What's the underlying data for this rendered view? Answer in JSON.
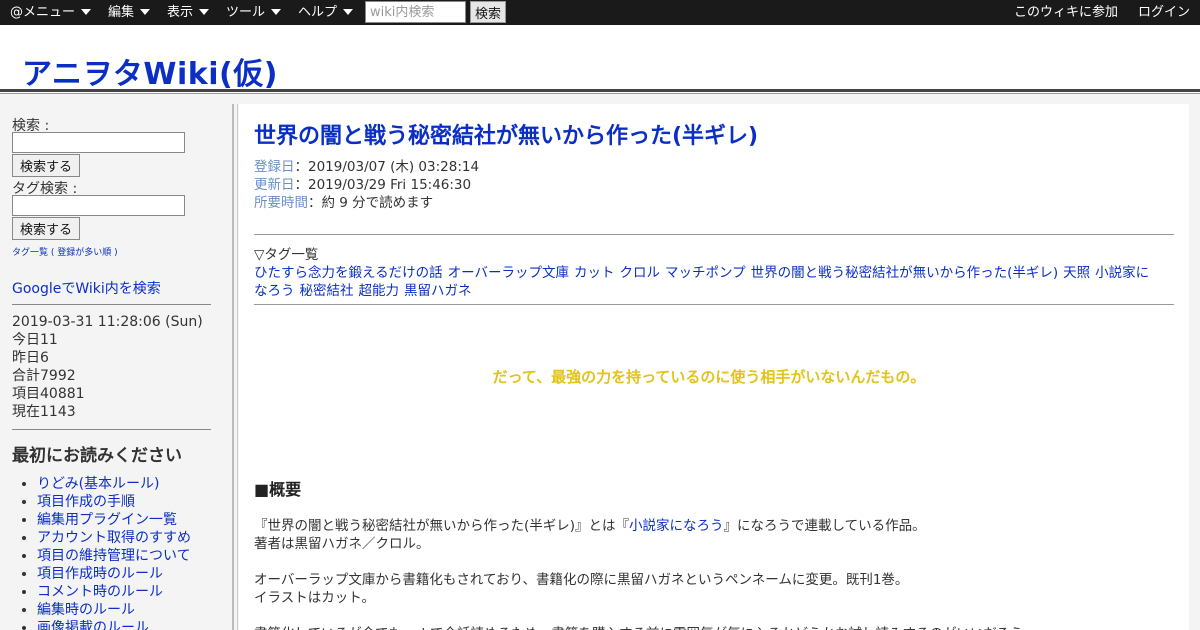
{
  "topbar": {
    "menus": [
      "@メニュー",
      "編集",
      "表示",
      "ツール",
      "ヘルプ"
    ],
    "search_placeholder": "wiki内検索",
    "search_button": "検索",
    "join": "このウィキに参加",
    "login": "ログイン",
    "bg_color": "#1a1a1a"
  },
  "header": {
    "site_title": "アニヲタWiki(仮)"
  },
  "sidebar": {
    "search_label": "検索 :",
    "search_button": "検索する",
    "tag_search_label": "タグ検索 :",
    "tag_search_button": "検索する",
    "tag_list_link": "タグ一覧",
    "tag_list_paren_open": "(",
    "tag_list_popular": "登録が多い順",
    "tag_list_paren_close": ")",
    "google_search": "GoogleでWiki内を検索",
    "datetime": "2019-03-31 11:28:06 (Sun)",
    "today": "今日11",
    "yesterday": "昨日6",
    "total": "合計7992",
    "items": "項目40881",
    "now": "現在1143",
    "heading": "最初にお読みください",
    "links": [
      "りどみ(基本ルール)",
      "項目作成の手順",
      "編集用プラグイン一覧",
      "アカウント取得のすすめ",
      "項目の維持管理について",
      "項目作成時のルール",
      "コメント時のルール",
      "編集時のルール",
      "画像掲載のルール"
    ]
  },
  "main": {
    "title": "世界の闇と戦う秘密結社が無いから作った(半ギレ)",
    "registered_label": "登録日",
    "registered_value": "：2019/03/07 (木) 03:28:14",
    "updated_label": "更新日",
    "updated_value": "：2019/03/29 Fri 15:46:30",
    "reading_label": "所要時間",
    "reading_value": "：約 9 分で読めます",
    "tags_heading": "▽タグ一覧",
    "tags_line1": [
      "ひたすら念力を鍛えるだけの話",
      "オーバーラップ文庫",
      "カット",
      "クロル",
      "マッチポンプ",
      "世界の闇と戦う秘密結社が無いから作った(半ギレ)",
      "天照",
      "小説家に"
    ],
    "tags_line2": [
      "なろう",
      "秘密結社",
      "超能力",
      "黒留ハガネ"
    ],
    "quote": "だって、最強の力を持っているのに使う相手がいないんだもの。",
    "quote_color": "#e2c31a",
    "section_heading": "■概要",
    "p1a_pre": "『世界の闇と戦う秘密結社が無いから作った(半ギレ)』とは『",
    "p1a_link": "小説家になろう",
    "p1a_post": "』になろうで連載している作品。",
    "p1b": "著者は黒留ハガネ／クロル。",
    "p2a": "オーバーラップ文庫から書籍化もされており、書籍化の際に黒留ハガネというペンネームに変更。既刊1巻。",
    "p2b": "イラストはカット。",
    "p3a": "書籍化しているが今でもwebで全話読めるため、書籍を購入する前に雰囲気が気に入るかどうかお試し読みするのがいいだろう。"
  },
  "colors": {
    "link": "#0b2fc4",
    "meta_key": "#6a8fc9"
  }
}
